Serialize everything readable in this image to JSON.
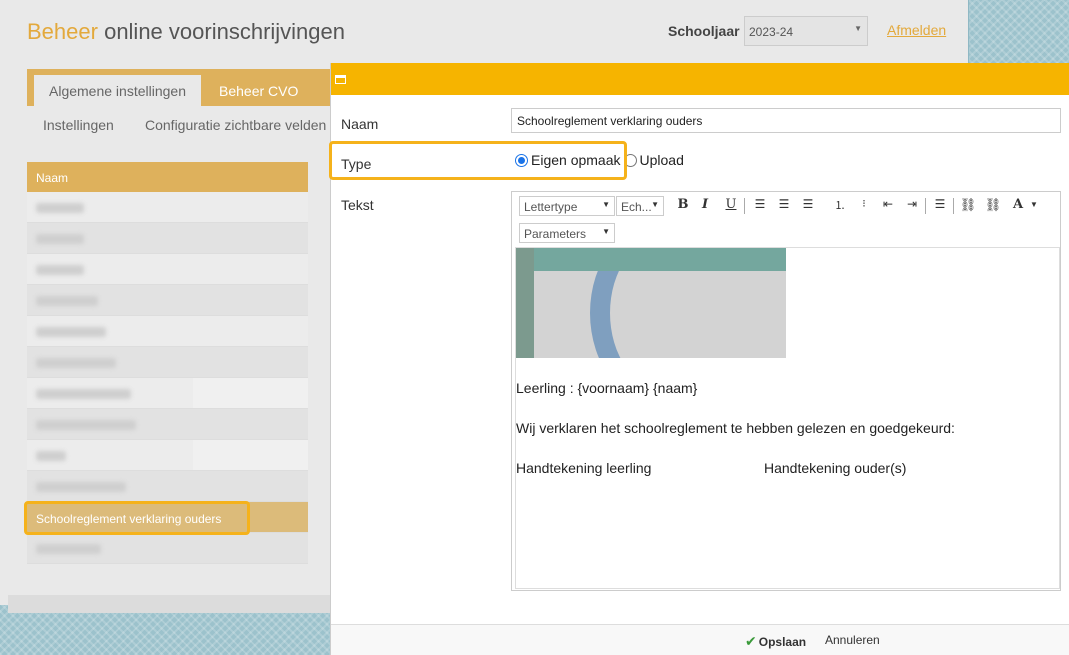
{
  "page": {
    "title_accent": "Beheer",
    "title_rest": "online voorinschrijvingen",
    "schoolyear_label": "Schooljaar",
    "schoolyear_value": "2023-24",
    "logout": "Afmelden"
  },
  "tabs": [
    {
      "label": "Algemene instellingen",
      "active": true
    },
    {
      "label": "Beheer CVO",
      "active": false
    }
  ],
  "subnav": [
    "Instellingen",
    "Configuratie zichtbare velden"
  ],
  "list": {
    "header": "Naam",
    "selected": "Schoolreglement verklaring ouders"
  },
  "dialog": {
    "naam_label": "Naam",
    "naam_value": "Schoolreglement  verklaring ouders",
    "type_label": "Type",
    "type_options": [
      "Eigen opmaak",
      "Upload"
    ],
    "type_selected": "Eigen opmaak",
    "tekst_label": "Tekst",
    "toolbar": {
      "font": "Lettertype",
      "size": "Ech...",
      "params": "Parameters"
    },
    "content": {
      "line1": "Leerling : {voornaam} {naam}",
      "line2": "Wij verklaren het schoolreglement te hebben gelezen en goedgekeurd:",
      "sig1": "Handtekening leerling",
      "sig2": "Handtekening ouder(s)"
    },
    "save": "Opslaan",
    "cancel": "Annuleren"
  },
  "colors": {
    "accent": "#f6b400",
    "tab_gold": "#deb15c",
    "highlight": "#f5b21b"
  }
}
